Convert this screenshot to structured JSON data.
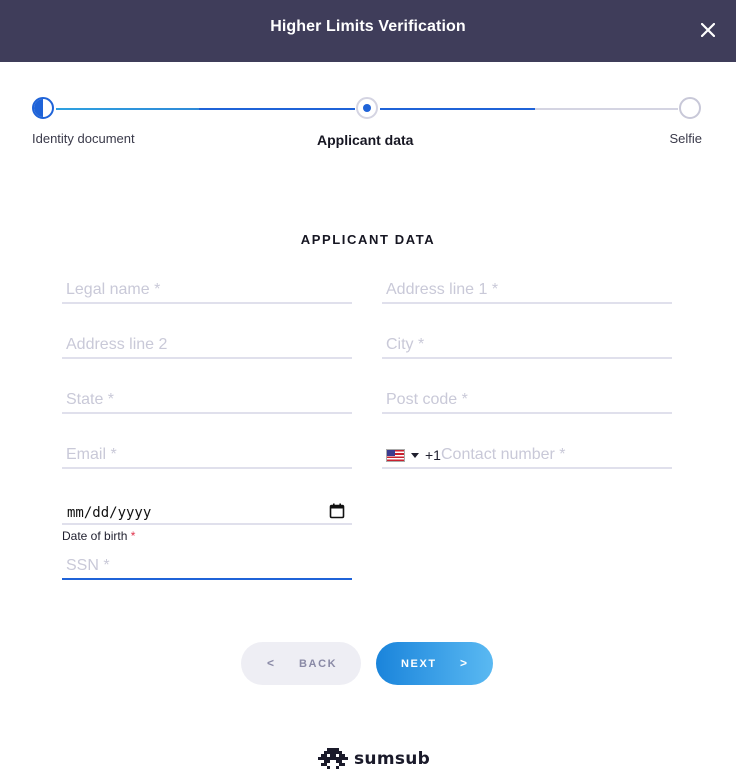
{
  "header": {
    "title": "Higher Limits Verification"
  },
  "stepper": {
    "steps": [
      {
        "label": "Identity document"
      },
      {
        "label": "Applicant data"
      },
      {
        "label": "Selfie"
      }
    ]
  },
  "form": {
    "title": "APPLICANT DATA",
    "legal_name": {
      "placeholder": "Legal name *"
    },
    "address_line_1": {
      "placeholder": "Address line 1 *"
    },
    "address_line_2": {
      "placeholder": "Address line 2"
    },
    "city": {
      "placeholder": "City *"
    },
    "state": {
      "placeholder": "State *"
    },
    "post_code": {
      "placeholder": "Post code *"
    },
    "email": {
      "placeholder": "Email *"
    },
    "phone": {
      "country_code": "+1",
      "placeholder": "Contact number *"
    },
    "dob": {
      "value": "mm/dd/yyyy",
      "label": "Date of birth",
      "required_mark": "*"
    },
    "ssn": {
      "placeholder": "SSN *"
    }
  },
  "buttons": {
    "back": {
      "chevron": "<",
      "label": "BACK"
    },
    "next": {
      "label": "NEXT",
      "chevron": ">"
    }
  },
  "brand": {
    "name": "sumsub"
  }
}
